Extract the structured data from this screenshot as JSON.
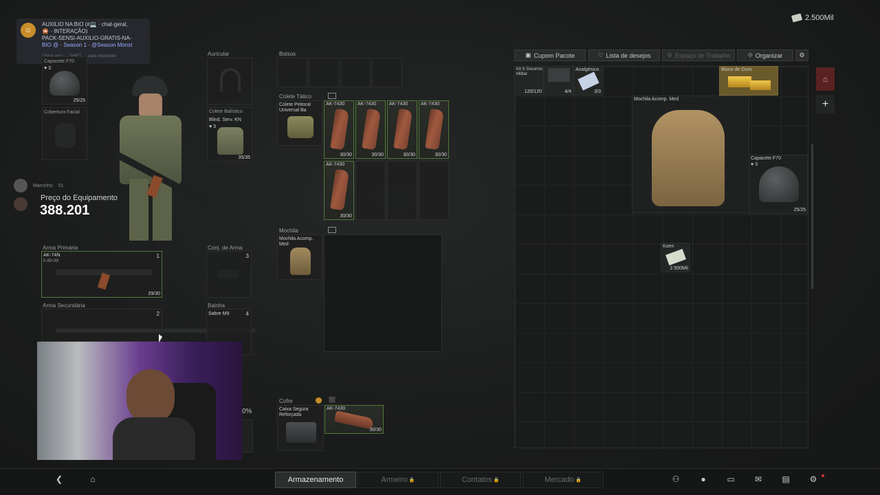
{
  "top_info": {
    "money": "2.500Mil"
  },
  "discord": {
    "line1": "AUXILIO NA BIO (#💻 · chat-geral,",
    "line2": "🎇 · INTERAÇÃO)",
    "line3": "PACK-SENSI-AUXILIO-GRATIS-NA-",
    "line4": "BIO @ · Season 1 - @Season Monst",
    "hint1": "Clique aqui",
    "hint2": "SHIFT",
    "hint3": "para responder"
  },
  "equipment": {
    "headgear_label": "Capacete F70",
    "headgear_sub": "♥ 3",
    "headgear_count": "25/25",
    "face_label": "Cobertura Facial",
    "earpiece_label": "Auricular",
    "armor_label": "Colete Balístico",
    "armor_item": "Blind. Serv. KN",
    "armor_sub": "♥ 3",
    "armor_count": "35/35",
    "players": [
      "Marcinho",
      "01"
    ],
    "price_label": "Preço do Equipamento",
    "price_value": "388.201",
    "primary_label": "Arma Primária",
    "primary_item": "AK-74N",
    "primary_caliber": "5.45×39",
    "primary_count": "29/30",
    "primary_slot": "1",
    "secondary_label": "Arma Secundária",
    "secondary_slot": "2",
    "weapon_set_label": "Conj. de Arma",
    "weapon_set_slot": "3",
    "holster_label": "Bainha",
    "holster_item": "Sabre M9",
    "holster_slot": "4",
    "partial_percent": "0%"
  },
  "containers": {
    "pockets_label": "Bolsos",
    "rig_label": "Colete Tático",
    "rig_item": "Colete Peitoral Universal Ba",
    "backpack_label": "Mochila",
    "backpack_item": "Mochila Acomp. Med",
    "safe_label": "Cofre",
    "safe_item": "Caixa Segura Reforçada"
  },
  "rig_mags": [
    {
      "name": "AK-7430",
      "count": "30/30"
    },
    {
      "name": "AK-7430",
      "count": "30/30"
    },
    {
      "name": "AK-7430",
      "count": "30/30"
    },
    {
      "name": "AK-7430",
      "count": "30/30"
    },
    {
      "name": "AK-7430",
      "count": "30/30"
    }
  ],
  "safe_mag": {
    "name": "AK-7430",
    "count": "30/30"
  },
  "toolbar": {
    "coupon": "Cupom Pacote",
    "wishlist": "Lista de desejos",
    "workspace": "Espaço de Trabalho",
    "organize": "Organizar"
  },
  "stash": {
    "kit_name": "Kit S Socorros Militar",
    "kit_count": "120/120",
    "item2_count": "4/4",
    "painkiller_name": "Analgésico",
    "painkiller_count": "3/3",
    "gold_name": "Bloco de Ouro",
    "backpack_name": "Mochila Acomp. Med",
    "helmet_name": "Capacete F70",
    "helmet_sub": "♥ 3",
    "helmet_count": "25/25",
    "cash_name": "Koen",
    "cash_count": "2.500Mil"
  },
  "bottom_nav": {
    "storage": "Armazenamento",
    "armory": "Armeiro",
    "contacts": "Contatos",
    "market": "Mercado"
  },
  "colors": {
    "accent_green": "#4f7a3a",
    "mag_orange": "#a0593f",
    "alert_red": "#7a2b2b"
  }
}
